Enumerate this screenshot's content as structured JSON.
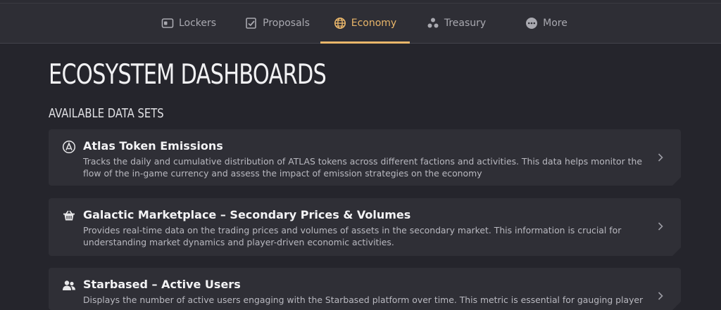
{
  "nav": {
    "tabs": [
      {
        "label": "Lockers",
        "icon": "wallet-icon"
      },
      {
        "label": "Proposals",
        "icon": "checklist-icon"
      },
      {
        "label": "Economy",
        "icon": "globe-icon",
        "active": true
      },
      {
        "label": "Treasury",
        "icon": "coins-icon"
      },
      {
        "label": "More",
        "icon": "more-icon"
      }
    ],
    "active_color": "#e9b66a"
  },
  "main": {
    "title": "ECOSYSTEM DASHBOARDS",
    "section_title": "AVAILABLE DATA SETS",
    "cards": [
      {
        "title": "Atlas Token Emissions",
        "description": "Tracks the daily and cumulative distribution of ATLAS tokens across different factions and activities. This data helps monitor the flow of the in-game currency and assess the impact of emission strategies on the economy",
        "icon": "atlas-icon"
      },
      {
        "title": "Galactic Marketplace – Secondary Prices & Volumes",
        "description": "Provides real-time data on the trading prices and volumes of assets in the secondary market. This information is crucial for understanding market dynamics and player-driven economic activities.",
        "icon": "basket-icon"
      },
      {
        "title": "Starbased – Active Users",
        "description": "Displays the number of active users engaging with the Starbased platform over time. This metric is essential for gauging player",
        "icon": "users-icon"
      }
    ]
  }
}
